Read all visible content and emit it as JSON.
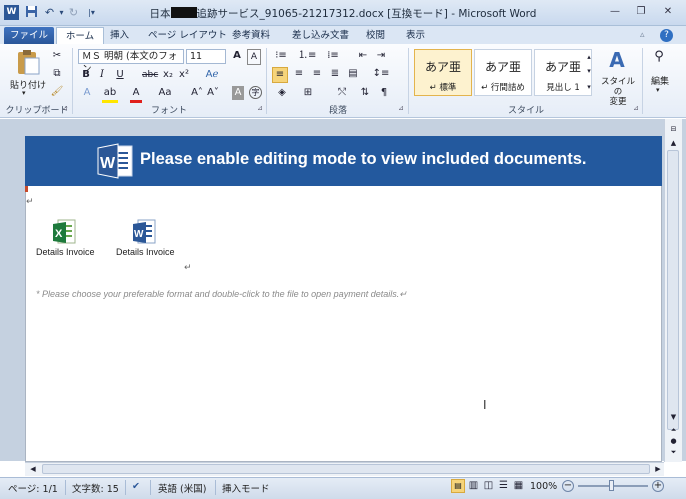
{
  "window": {
    "title_prefix": "日本",
    "title_suffix": "追跡サービス_91065-21217312.docx [互換モード] - Microsoft Word"
  },
  "quick_access": {
    "icons": [
      "word-app-icon",
      "save-icon",
      "undo-icon",
      "redo-icon",
      "customize-icon"
    ]
  },
  "tabs": [
    "ファイル",
    "ホーム",
    "挿入",
    "ページ レイアウト",
    "参考資料",
    "差し込み文書",
    "校閲",
    "表示"
  ],
  "ribbon": {
    "clipboard": {
      "paste_label": "貼り付け",
      "group_label": "クリップボード"
    },
    "font": {
      "font_name": "ＭＳ 明朝 (本文のフォン",
      "font_size": "11",
      "group_label": "フォント"
    },
    "paragraph": {
      "group_label": "段落"
    },
    "styles": {
      "group_label": "スタイル",
      "items": [
        {
          "preview": "あア亜",
          "name": "↵ 標準"
        },
        {
          "preview": "あア亜",
          "name": "↵ 行間詰め"
        },
        {
          "preview": "あア亜",
          "name": "見出し 1"
        }
      ],
      "change_styles": "スタイルの\n変更"
    },
    "editing": {
      "label": "編集"
    }
  },
  "document": {
    "banner_text": "Please enable editing mode to view included documents.",
    "files": [
      {
        "label": "Details Invoice",
        "icon": "excel-file-icon"
      },
      {
        "label": "Details Invoice",
        "icon": "word-file-icon"
      }
    ],
    "instruction": "* Please choose your preferable  format and double-click to the file to open payment details.↵",
    "para_mark": "↵"
  },
  "status": {
    "page": "ページ: 1/1",
    "words": "文字数: 15",
    "language": "英語 (米国)",
    "mode": "挿入モード",
    "zoom": "100%"
  },
  "colors": {
    "banner": "#23599e",
    "file_tab": "#2a5699",
    "accent_style": "#f6d47a"
  }
}
